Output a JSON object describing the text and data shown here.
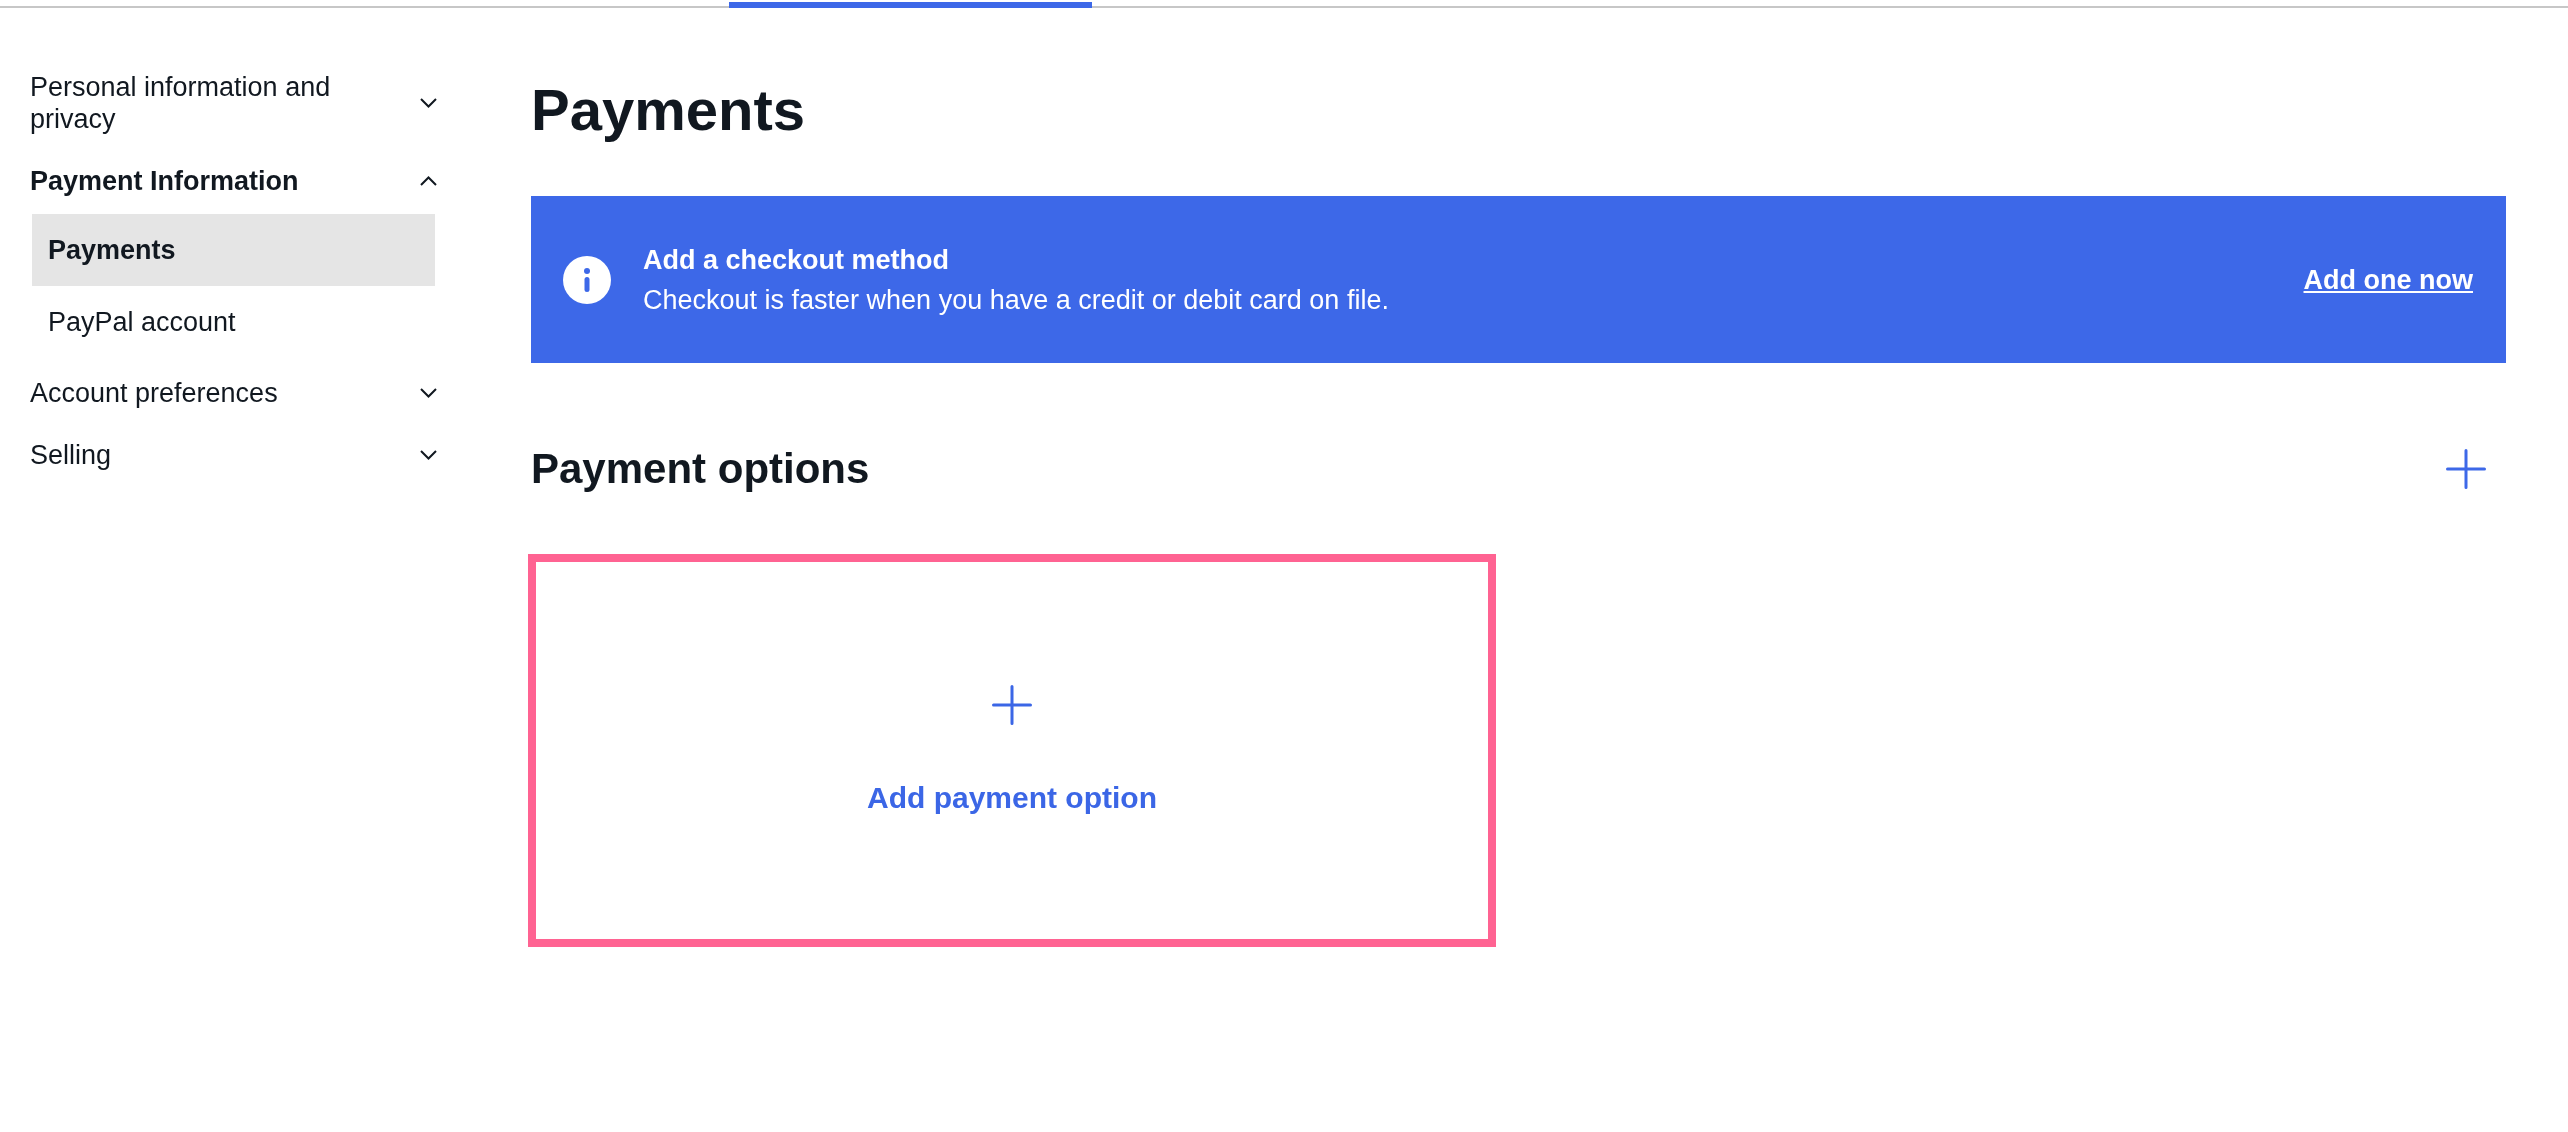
{
  "sidebar": {
    "sections": [
      {
        "label": "Personal information and privacy",
        "expanded": false
      },
      {
        "label": "Payment Information",
        "expanded": true,
        "children": [
          {
            "label": "Payments",
            "selected": true
          },
          {
            "label": "PayPal account",
            "selected": false
          }
        ]
      },
      {
        "label": "Account preferences",
        "expanded": false
      },
      {
        "label": "Selling",
        "expanded": false
      }
    ]
  },
  "page_title": "Payments",
  "banner": {
    "title": "Add a checkout method",
    "message": "Checkout is faster when you have a credit or debit card on file.",
    "link": "Add one now"
  },
  "payment_options": {
    "title": "Payment options",
    "add_card": {
      "label": "Add payment option",
      "highlighted": true
    }
  }
}
